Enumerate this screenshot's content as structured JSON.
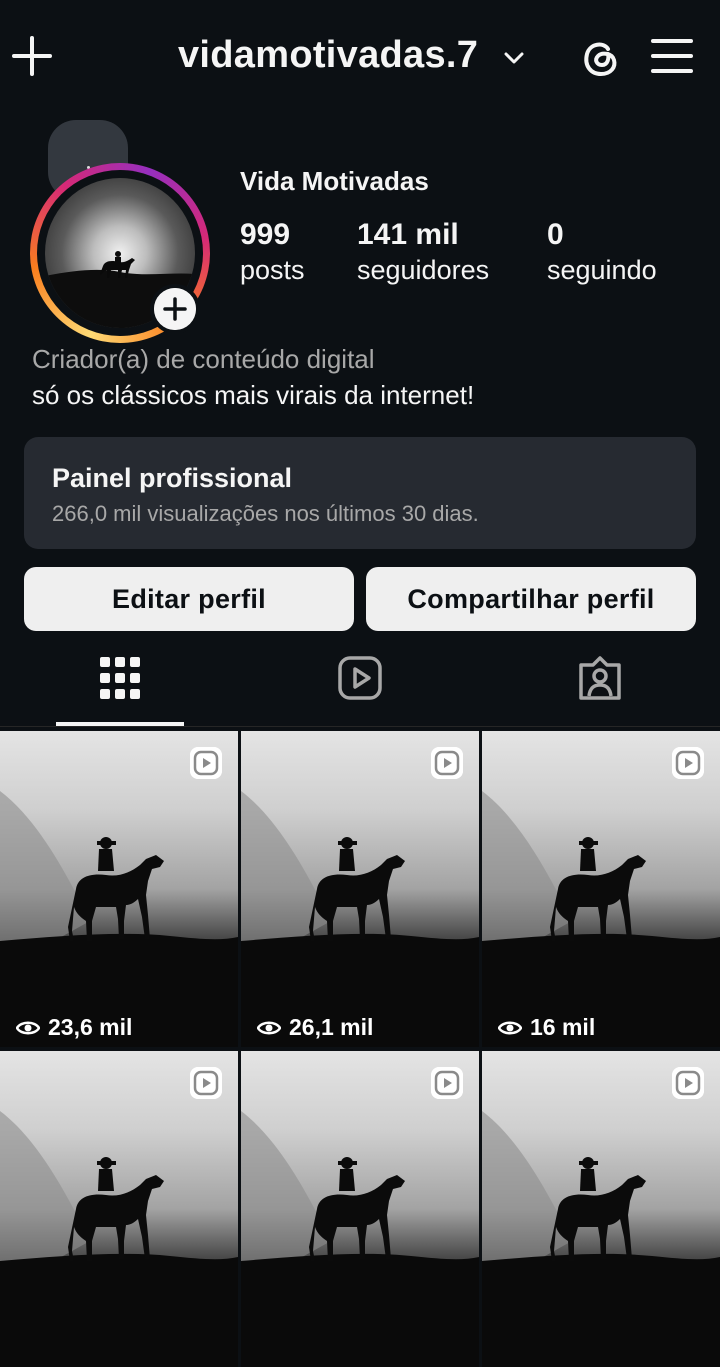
{
  "header": {
    "username": "vidamotivadas.7"
  },
  "profile": {
    "display_name": "Vida Motivadas",
    "stats": [
      {
        "value": "999",
        "label": "posts"
      },
      {
        "value": "141 mil",
        "label": "seguidores"
      },
      {
        "value": "0",
        "label": "seguindo"
      }
    ],
    "category": "Criador(a) de conteúdo digital",
    "bio": "só os clássicos mais virais da internet!"
  },
  "dashboard": {
    "title": "Painel profissional",
    "subtitle": "266,0 mil visualizações nos últimos 30 dias."
  },
  "buttons": {
    "edit": "Editar perfil",
    "share": "Compartilhar perfil"
  },
  "tabs": [
    {
      "icon": "grid-icon",
      "active": true
    },
    {
      "icon": "reels-icon",
      "active": false
    },
    {
      "icon": "tagged-icon",
      "active": false
    }
  ],
  "posts": [
    {
      "views": "23,6 mil"
    },
    {
      "views": "26,1 mil"
    },
    {
      "views": "16 mil"
    },
    {
      "views": ""
    },
    {
      "views": ""
    },
    {
      "views": ""
    }
  ],
  "colors": {
    "background": "#0c1014",
    "surface": "#262a31",
    "button": "#efefef",
    "muted_text": "#a8a8a8"
  }
}
